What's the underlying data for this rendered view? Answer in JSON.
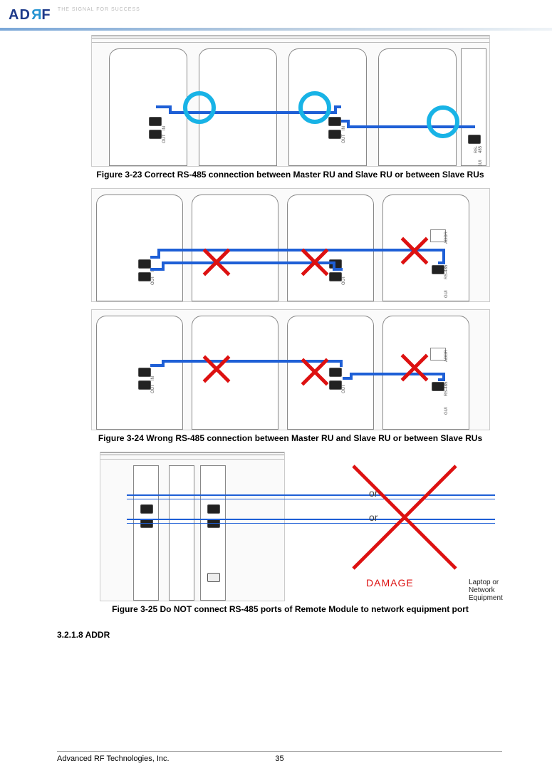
{
  "header": {
    "logo_text": "ADRF",
    "tagline": "THE SIGNAL FOR SUCCESS"
  },
  "figures": {
    "f23_caption": "Figure 3-23    Correct RS-485 connection between Master RU and Slave RU or between Slave RUs",
    "f24_caption": "Figure 3-24    Wrong RS-485 connection between Master RU and Slave RU or between Slave RUs",
    "f25_caption": "Figure 3-25    Do NOT connect RS-485 ports of Remote Module to network equipment port",
    "f25_or1": "or",
    "f25_or2": "or",
    "f25_damage": "DAMAGE",
    "f25_note": "Laptop or Network Equipment"
  },
  "labels": {
    "in": "IN",
    "out": "OUT",
    "rs485": "RS-485",
    "gui": "GUI",
    "addr": "ADDR"
  },
  "sections": {
    "s3218": "3.2.1.8    ADDR"
  },
  "footer": {
    "company": "Advanced RF Technologies, Inc.",
    "page": "35"
  }
}
